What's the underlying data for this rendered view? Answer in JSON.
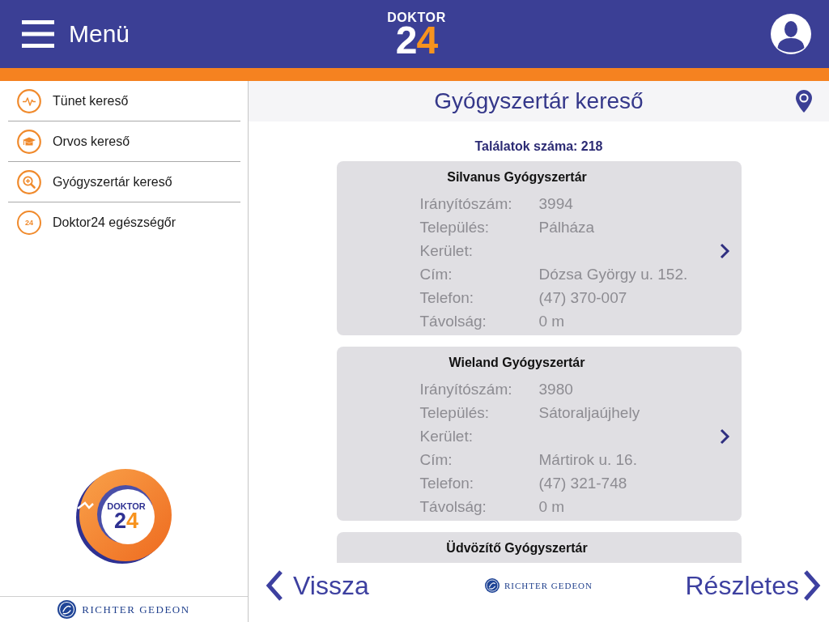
{
  "header": {
    "menu_label": "Menü",
    "logo": {
      "word": "DOKTOR",
      "number": "24"
    }
  },
  "sidebar": {
    "items": [
      {
        "label": "Tünet kereső",
        "kind": "pulse"
      },
      {
        "label": "Orvos kereső",
        "kind": "cap"
      },
      {
        "label": "Gyógyszertár kereső",
        "kind": "search"
      },
      {
        "label": "Doktor24 egészségőr",
        "kind": "badge",
        "badge": "24"
      }
    ],
    "logo": {
      "word": "DOKTOR",
      "number": "24"
    },
    "brand": "RICHTER GEDEON"
  },
  "main": {
    "title": "Gyógyszertár kereső",
    "result_count": "Találatok száma: 218",
    "pharmacies": [
      {
        "name": "Silvanus Gyógyszertár",
        "fields": [
          {
            "label": "Irányítószám:",
            "value": "3994"
          },
          {
            "label": "Település:",
            "value": "Pálháza"
          },
          {
            "label": "Kerület:"
          },
          {
            "label": "Cím:",
            "value": "Dózsa György u. 152."
          },
          {
            "label": "Telefon:",
            "value": "(47) 370-007"
          },
          {
            "label": "Távolság:",
            "value": "0 m"
          }
        ]
      },
      {
        "name": "Wieland Gyógyszertár",
        "fields": [
          {
            "label": "Irányítószám:",
            "value": "3980"
          },
          {
            "label": "Település:",
            "value": "Sátoraljaújhely"
          },
          {
            "label": "Kerület:"
          },
          {
            "label": "Cím:",
            "value": "Mártirok u. 16."
          },
          {
            "label": "Telefon:",
            "value": "(47) 321-748"
          },
          {
            "label": "Távolság:",
            "value": "0 m"
          }
        ]
      },
      {
        "name": "Üdvözítő Gyógyszertár"
      }
    ],
    "back_label": "Vissza",
    "brand": "RICHTER GEDEON",
    "details_label": "Részletes"
  }
}
